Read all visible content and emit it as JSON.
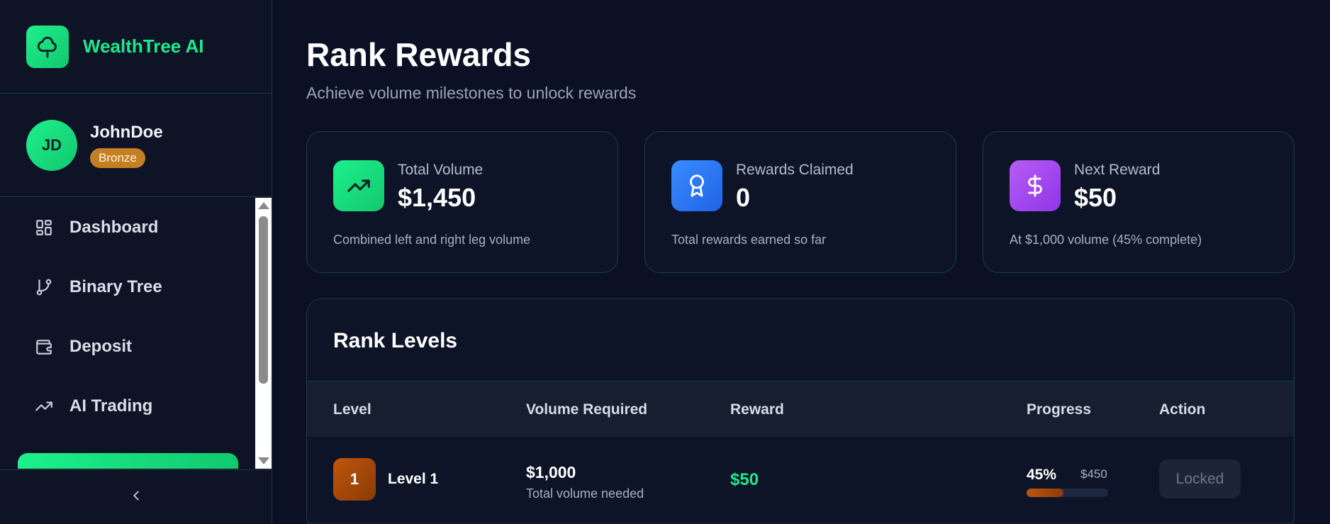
{
  "brand": {
    "name": "WealthTree AI",
    "logo_icon": "tree-icon"
  },
  "user": {
    "initials": "JD",
    "name": "JohnDoe",
    "rank": "Bronze"
  },
  "nav": {
    "items": [
      {
        "label": "Dashboard",
        "icon": "dashboard-icon"
      },
      {
        "label": "Binary Tree",
        "icon": "git-branch-icon"
      },
      {
        "label": "Deposit",
        "icon": "wallet-icon"
      },
      {
        "label": "AI Trading",
        "icon": "trending-up-icon"
      }
    ],
    "collapse_icon": "chevron-left-icon"
  },
  "page": {
    "title": "Rank Rewards",
    "subtitle": "Achieve volume milestones to unlock rewards"
  },
  "stats": [
    {
      "label": "Total Volume",
      "value": "$1,450",
      "desc": "Combined left and right leg volume",
      "icon": "trending-up-icon",
      "color": "#1de98b"
    },
    {
      "label": "Rewards Claimed",
      "value": "0",
      "desc": "Total rewards earned so far",
      "icon": "award-icon",
      "color": "#2f7df6"
    },
    {
      "label": "Next Reward",
      "value": "$50",
      "desc": "At $1,000 volume (45% complete)",
      "icon": "dollar-icon",
      "color": "#a24cf0"
    }
  ],
  "levels": {
    "title": "Rank Levels",
    "headers": {
      "level": "Level",
      "volume": "Volume Required",
      "reward": "Reward",
      "progress": "Progress",
      "action": "Action"
    },
    "rows": [
      {
        "badge": "1",
        "name": "Level 1",
        "volume": "$1,000",
        "volume_sub": "Total volume needed",
        "reward": "$50",
        "progress_pct": "45%",
        "progress_value": 0.45,
        "progress_amount": "$450",
        "action": "Locked"
      }
    ]
  }
}
